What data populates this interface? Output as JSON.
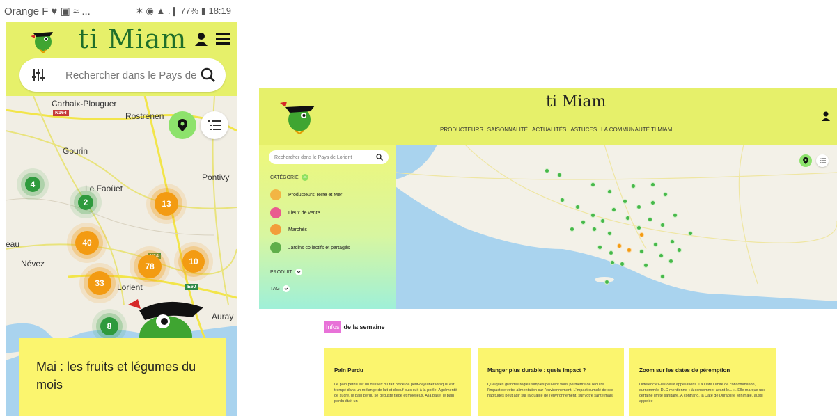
{
  "phone": {
    "status": {
      "left": "Orange F ♥ ▣ ≈ ...",
      "right": "✶ ◉ ▲ .❙ 77% ▮ 18:19"
    },
    "logo": "ti Miam",
    "search_placeholder": "Rechercher dans le Pays de",
    "map": {
      "towns": [
        "Carhaix-Plouguer",
        "Rostrenen",
        "Gourin",
        "Pontivy",
        "Le Faoüet",
        "Lorient",
        "Névez",
        "Auray",
        "eau"
      ],
      "road_labels": [
        "N164",
        "N24",
        "E60"
      ],
      "clusters": [
        {
          "count": "4",
          "color": "green"
        },
        {
          "count": "2",
          "color": "green"
        },
        {
          "count": "13",
          "color": "orange"
        },
        {
          "count": "40",
          "color": "orange"
        },
        {
          "count": "78",
          "color": "orange"
        },
        {
          "count": "10",
          "color": "orange"
        },
        {
          "count": "33",
          "color": "orange"
        },
        {
          "count": "8",
          "color": "green"
        }
      ]
    },
    "card_title": "Mai : les fruits et légumes du mois"
  },
  "desktop": {
    "logo": "ti Miam",
    "nav": [
      "PRODUCTEURS",
      "SAISONNALITÉ",
      "ACTUALITÉS",
      "ASTUCES",
      "LA COMMUNAUTÉ TI MIAM"
    ],
    "search_placeholder": "Rechercher dans le Pays de Lorient",
    "category_label": "CATÉGORIE",
    "categories": [
      "Producteurs Terre et Mer",
      "Lieux de vente",
      "Marchés",
      "Jardins collectifs et partagés"
    ],
    "product_label": "PRODUIT",
    "tag_label": "TAG",
    "infos_badge": "Infos",
    "infos_rest": "de la semaine",
    "cards": [
      {
        "title": "Pain Perdu",
        "text": "Le pain perdu est un dessert ou fait office de petit-déjeuner lorsqu'il est trempé dans un mélange de lait et d'oeuf puis cuit à la poêle. Agrémenté de sucre, le pain perdu se déguste tiède et moelleux. A la base, le pain perdu était un"
      },
      {
        "title": "Manger plus durable : quels impact ?",
        "text": "Quelques grandes règles simples peuvent vous permettre de réduire l'impact de votre alimentation sur l'environnement. L'impact cumulé de ces habitudes peut agir sur la qualité de l'environnement, sur votre santé mais"
      },
      {
        "title": "Zoom sur les dates de péremption",
        "text": "Différenciez-les deux appellations. La Date Limite de consommation, surnommée DLC mentionne « à consommer avant le... ». Elle marque une certaine limite sanitaire. A contrario, la Date de Durabilité Minimale, aussi appelée"
      }
    ]
  },
  "colors": {
    "brand_yellow": "#e6f06a",
    "card_yellow": "#fbf56e",
    "cluster_green": "#2e9a3d",
    "cluster_orange": "#f39b12",
    "infos_pink": "#e872d8",
    "logo_green": "#1f6f2a"
  },
  "icons": [
    "bird-logo-icon",
    "user-icon",
    "menu-icon",
    "filter-icon",
    "search-icon",
    "map-pin-icon",
    "list-icon",
    "chevron-icon"
  ]
}
